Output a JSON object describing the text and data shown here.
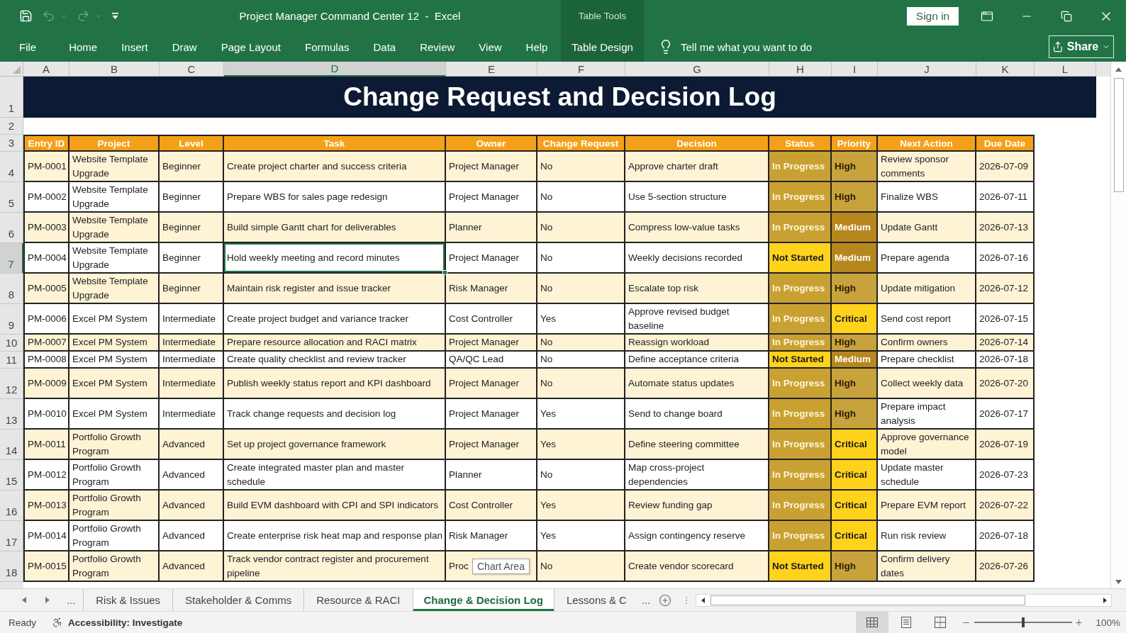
{
  "window": {
    "title": "Project Manager Command Center 12  -  Excel",
    "context_group": "Table Tools",
    "sign_in": "Sign in"
  },
  "quick_access": [
    {
      "kind": "save",
      "disabled": false
    },
    {
      "kind": "undo",
      "disabled": true
    },
    {
      "kind": "redo",
      "disabled": true
    }
  ],
  "ribbon_tabs": [
    {
      "label": "File",
      "kind": "file"
    },
    {
      "label": "Home",
      "kind": "standard"
    },
    {
      "label": "Insert",
      "kind": "standard"
    },
    {
      "label": "Draw",
      "kind": "standard"
    },
    {
      "label": "Page Layout",
      "kind": "standard"
    },
    {
      "label": "Formulas",
      "kind": "standard"
    },
    {
      "label": "Data",
      "kind": "standard"
    },
    {
      "label": "Review",
      "kind": "standard"
    },
    {
      "label": "View",
      "kind": "standard"
    },
    {
      "label": "Help",
      "kind": "standard"
    },
    {
      "label": "Table Design",
      "kind": "contextual"
    }
  ],
  "tell_me": {
    "placeholder": "Tell me what you want to do"
  },
  "share": {
    "label": "Share"
  },
  "columns": [
    {
      "label": "A",
      "selected": false
    },
    {
      "label": "B",
      "selected": false
    },
    {
      "label": "C",
      "selected": false
    },
    {
      "label": "D",
      "selected": true
    },
    {
      "label": "E",
      "selected": false
    },
    {
      "label": "F",
      "selected": false
    },
    {
      "label": "G",
      "selected": false
    },
    {
      "label": "H",
      "selected": false
    },
    {
      "label": "I",
      "selected": false
    },
    {
      "label": "J",
      "selected": false
    },
    {
      "label": "K",
      "selected": false
    },
    {
      "label": "L",
      "selected": false
    }
  ],
  "sheet": {
    "title_row": "1",
    "title": "Change Request and Decision Log",
    "blank_row": "2",
    "header_row": "3",
    "headers": [
      "Entry ID",
      "Project",
      "Level",
      "Task",
      "Owner",
      "Change Request",
      "Decision",
      "Status",
      "Priority",
      "Next Action",
      "Due Date"
    ],
    "rows": [
      {
        "row_number": "4",
        "selected": false,
        "entry_id": "PM-0001",
        "project": "Website Template Upgrade",
        "level": "Beginner",
        "task": "Create project charter and success criteria",
        "owner": "Project Manager",
        "change_request": "No",
        "decision": "Approve charter draft",
        "status": {
          "label": "In Progress",
          "kind": "in_progress"
        },
        "priority": {
          "label": "High",
          "kind": "high"
        },
        "next_action": "Review sponsor comments",
        "due_date": "2026-07-09"
      },
      {
        "row_number": "5",
        "selected": false,
        "entry_id": "PM-0002",
        "project": "Website Template Upgrade",
        "level": "Beginner",
        "task": "Prepare WBS for sales page redesign",
        "owner": "Project Manager",
        "change_request": "No",
        "decision": "Use 5-section structure",
        "status": {
          "label": "In Progress",
          "kind": "in_progress"
        },
        "priority": {
          "label": "High",
          "kind": "high"
        },
        "next_action": "Finalize WBS",
        "due_date": "2026-07-11"
      },
      {
        "row_number": "6",
        "selected": false,
        "entry_id": "PM-0003",
        "project": "Website Template Upgrade",
        "level": "Beginner",
        "task": "Build simple Gantt chart for deliverables",
        "owner": "Planner",
        "change_request": "No",
        "decision": "Compress low-value tasks",
        "status": {
          "label": "In Progress",
          "kind": "in_progress"
        },
        "priority": {
          "label": "Medium",
          "kind": "medium"
        },
        "next_action": "Update Gantt",
        "due_date": "2026-07-13"
      },
      {
        "row_number": "7",
        "selected": true,
        "entry_id": "PM-0004",
        "project": "Website Template Upgrade",
        "level": "Beginner",
        "task": "Hold weekly meeting and record minutes",
        "owner": "Project Manager",
        "change_request": "No",
        "decision": "Weekly decisions recorded",
        "status": {
          "label": "Not Started",
          "kind": "not_started"
        },
        "priority": {
          "label": "Medium",
          "kind": "medium"
        },
        "next_action": "Prepare agenda",
        "due_date": "2026-07-16"
      },
      {
        "row_number": "8",
        "selected": false,
        "entry_id": "PM-0005",
        "project": "Website Template Upgrade",
        "level": "Beginner",
        "task": "Maintain risk register and issue tracker",
        "owner": "Risk Manager",
        "change_request": "No",
        "decision": "Escalate top risk",
        "status": {
          "label": "In Progress",
          "kind": "in_progress"
        },
        "priority": {
          "label": "High",
          "kind": "high"
        },
        "next_action": "Update mitigation",
        "due_date": "2026-07-12"
      },
      {
        "row_number": "9",
        "selected": false,
        "entry_id": "PM-0006",
        "project": "Excel PM System",
        "level": "Intermediate",
        "task": "Create project budget and variance tracker",
        "owner": "Cost Controller",
        "change_request": "Yes",
        "decision": "Approve revised budget baseline",
        "status": {
          "label": "In Progress",
          "kind": "in_progress"
        },
        "priority": {
          "label": "Critical",
          "kind": "critical"
        },
        "next_action": "Send cost report",
        "due_date": "2026-07-15"
      },
      {
        "row_number": "10",
        "selected": false,
        "entry_id": "PM-0007",
        "project": "Excel PM System",
        "level": "Intermediate",
        "task": "Prepare resource allocation and RACI matrix",
        "owner": "Project Manager",
        "change_request": "No",
        "decision": "Reassign workload",
        "status": {
          "label": "In Progress",
          "kind": "in_progress"
        },
        "priority": {
          "label": "High",
          "kind": "high"
        },
        "next_action": "Confirm owners",
        "due_date": "2026-07-14"
      },
      {
        "row_number": "11",
        "selected": false,
        "entry_id": "PM-0008",
        "project": "Excel PM System",
        "level": "Intermediate",
        "task": "Create quality checklist and review tracker",
        "owner": "QA/QC Lead",
        "change_request": "No",
        "decision": "Define acceptance criteria",
        "status": {
          "label": "Not Started",
          "kind": "not_started"
        },
        "priority": {
          "label": "Medium",
          "kind": "medium"
        },
        "next_action": "Prepare checklist",
        "due_date": "2026-07-18"
      },
      {
        "row_number": "12",
        "selected": false,
        "entry_id": "PM-0009",
        "project": "Excel PM System",
        "level": "Intermediate",
        "task": "Publish weekly status report and KPI dashboard",
        "owner": "Project Manager",
        "change_request": "No",
        "decision": "Automate status updates",
        "status": {
          "label": "In Progress",
          "kind": "in_progress"
        },
        "priority": {
          "label": "High",
          "kind": "high"
        },
        "next_action": "Collect weekly data",
        "due_date": "2026-07-20"
      },
      {
        "row_number": "13",
        "selected": false,
        "entry_id": "PM-0010",
        "project": "Excel PM System",
        "level": "Intermediate",
        "task": "Track change requests and decision log",
        "owner": "Project Manager",
        "change_request": "Yes",
        "decision": "Send to change board",
        "status": {
          "label": "In Progress",
          "kind": "in_progress"
        },
        "priority": {
          "label": "High",
          "kind": "high"
        },
        "next_action": "Prepare impact analysis",
        "due_date": "2026-07-17"
      },
      {
        "row_number": "14",
        "selected": false,
        "entry_id": "PM-0011",
        "project": "Portfolio Growth Program",
        "level": "Advanced",
        "task": "Set up project governance framework",
        "owner": "Project Manager",
        "change_request": "Yes",
        "decision": "Define steering committee",
        "status": {
          "label": "In Progress",
          "kind": "in_progress"
        },
        "priority": {
          "label": "Critical",
          "kind": "critical"
        },
        "next_action": "Approve governance model",
        "due_date": "2026-07-19"
      },
      {
        "row_number": "15",
        "selected": false,
        "entry_id": "PM-0012",
        "project": "Portfolio Growth Program",
        "level": "Advanced",
        "task": "Create integrated master plan and master schedule",
        "owner": "Planner",
        "change_request": "No",
        "decision": "Map cross-project dependencies",
        "status": {
          "label": "In Progress",
          "kind": "in_progress"
        },
        "priority": {
          "label": "Critical",
          "kind": "critical"
        },
        "next_action": "Update master schedule",
        "due_date": "2026-07-23"
      },
      {
        "row_number": "16",
        "selected": false,
        "entry_id": "PM-0013",
        "project": "Portfolio Growth Program",
        "level": "Advanced",
        "task": "Build EVM dashboard with CPI and SPI indicators",
        "owner": "Cost Controller",
        "change_request": "Yes",
        "decision": "Review funding gap",
        "status": {
          "label": "In Progress",
          "kind": "in_progress"
        },
        "priority": {
          "label": "Critical",
          "kind": "critical"
        },
        "next_action": "Prepare EVM report",
        "due_date": "2026-07-22"
      },
      {
        "row_number": "17",
        "selected": false,
        "entry_id": "PM-0014",
        "project": "Portfolio Growth Program",
        "level": "Advanced",
        "task": "Create enterprise risk heat map and response plan",
        "owner": "Risk Manager",
        "change_request": "Yes",
        "decision": "Assign contingency reserve",
        "status": {
          "label": "In Progress",
          "kind": "in_progress"
        },
        "priority": {
          "label": "Critical",
          "kind": "critical"
        },
        "next_action": "Run risk review",
        "due_date": "2026-07-18"
      },
      {
        "row_number": "18",
        "selected": false,
        "entry_id": "PM-0015",
        "project": "Portfolio Growth Program",
        "level": "Advanced",
        "task": "Track vendor contract register and procurement pipeline",
        "owner": "Proc",
        "tooltip": "Chart Area",
        "change_request": "No",
        "decision": "Create vendor scorecard",
        "status": {
          "label": "Not Started",
          "kind": "not_started"
        },
        "priority": {
          "label": "High",
          "kind": "high"
        },
        "next_action": "Confirm delivery dates",
        "due_date": "2026-07-26"
      }
    ]
  },
  "sheet_tabs": {
    "overflow_left": "...",
    "tabs": [
      {
        "label": "Risk & Issues",
        "selected": false
      },
      {
        "label": "Stakeholder & Comms",
        "selected": false
      },
      {
        "label": "Resource & RACI",
        "selected": false
      },
      {
        "label": "Change & Decision Log",
        "selected": true
      },
      {
        "label": "Lessons & C",
        "selected": false
      }
    ],
    "overflow_right": "..."
  },
  "status_bar": {
    "ready": "Ready",
    "accessibility": "Accessibility: Investigate",
    "views": [
      {
        "kind": "normal",
        "selected": true
      },
      {
        "kind": "page_layout",
        "selected": false
      },
      {
        "kind": "page_break",
        "selected": false
      }
    ],
    "zoom": {
      "level": 0.5,
      "reading": "100%"
    }
  }
}
